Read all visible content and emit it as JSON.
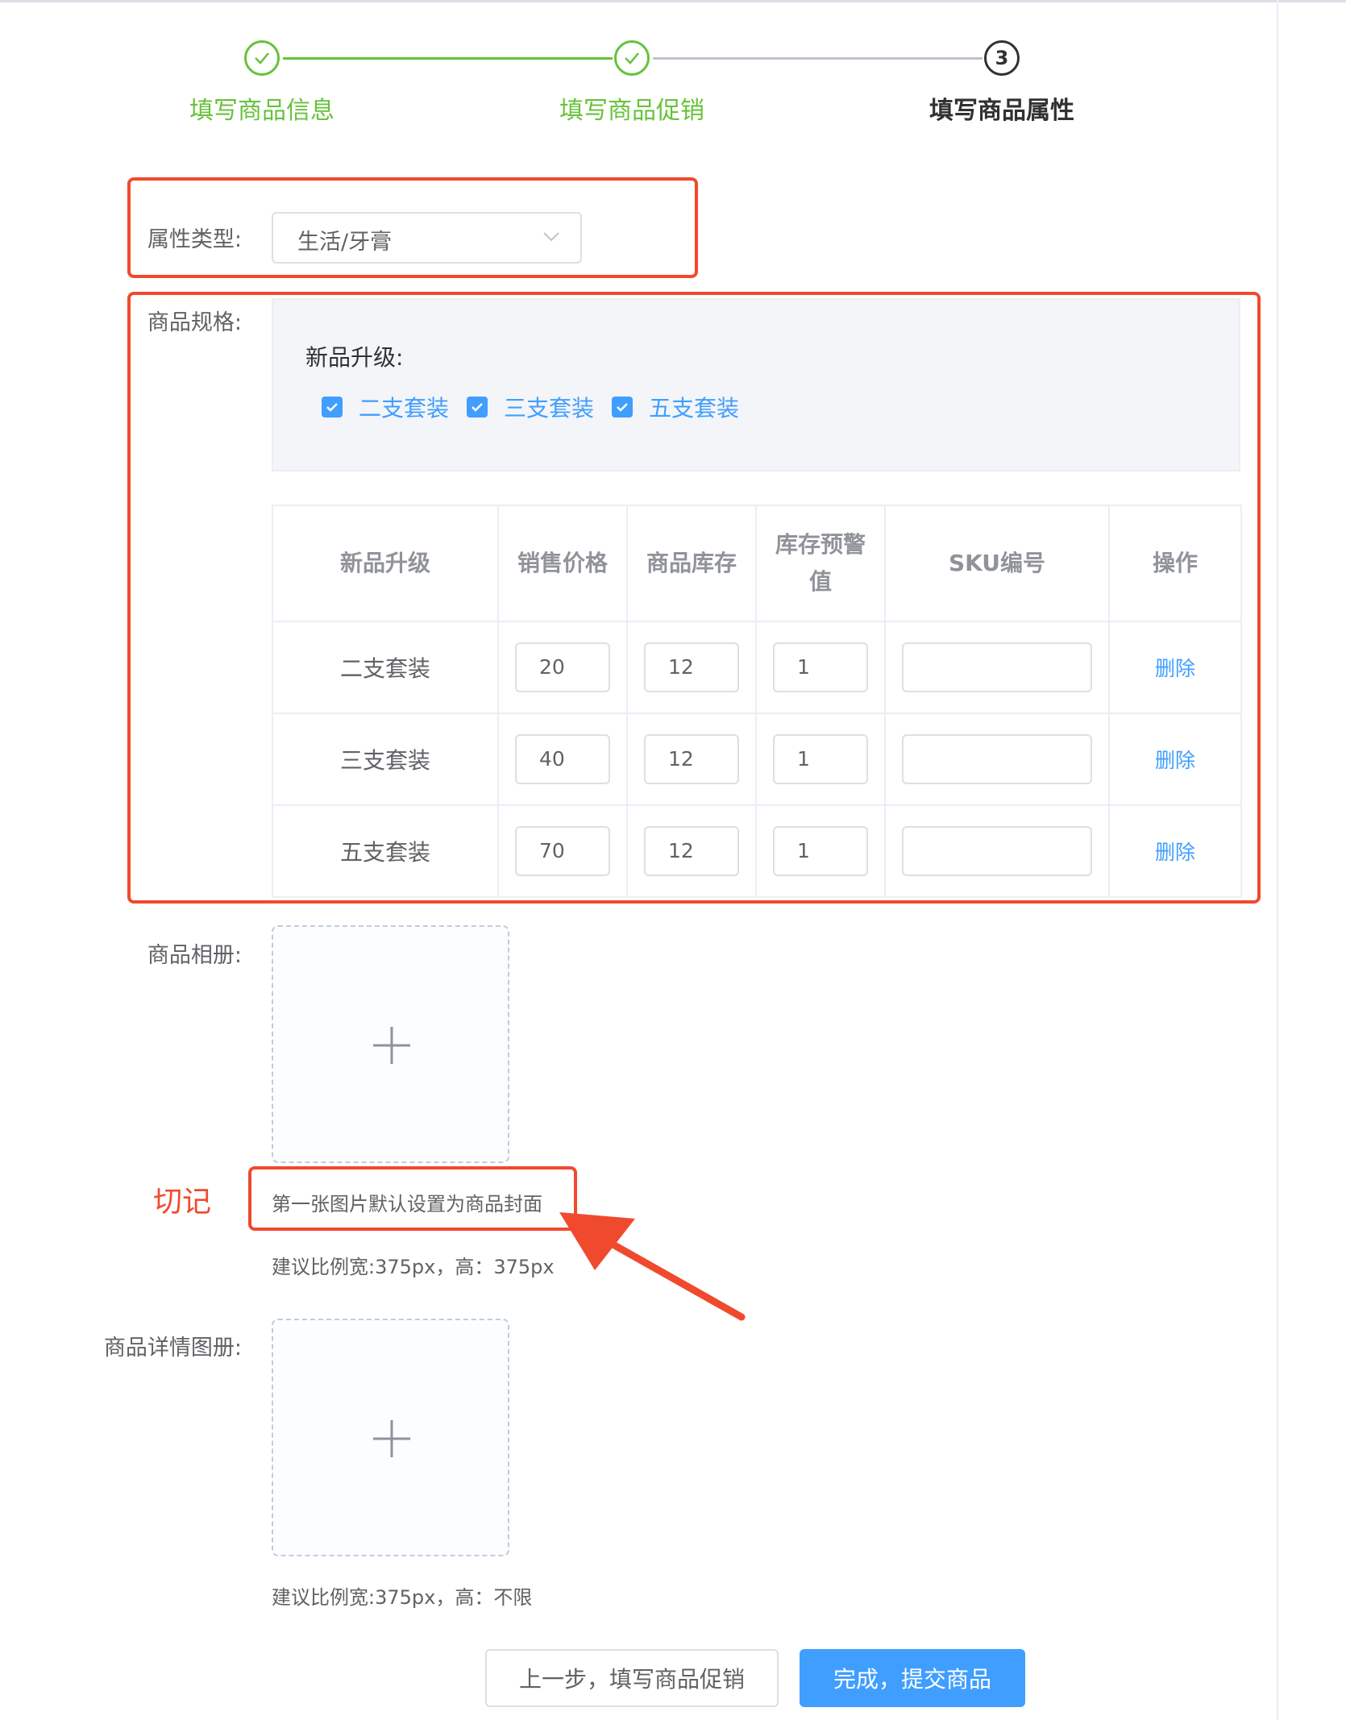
{
  "steps": [
    {
      "title": "填写商品信息",
      "status": "done"
    },
    {
      "title": "填写商品促销",
      "status": "done"
    },
    {
      "title": "填写商品属性",
      "status": "current",
      "number": "3"
    }
  ],
  "attr_type": {
    "label": "属性类型:",
    "value": "生活/牙膏"
  },
  "spec": {
    "label": "商品规格:",
    "group_title": "新品升级:",
    "options": [
      {
        "label": "二支套装",
        "checked": true
      },
      {
        "label": "三支套装",
        "checked": true
      },
      {
        "label": "五支套装",
        "checked": true
      }
    ]
  },
  "sku_table": {
    "headers": [
      "新品升级",
      "销售价格",
      "商品库存",
      "库存预警值",
      "SKU编号",
      "操作"
    ],
    "rows": [
      {
        "name": "二支套装",
        "price": "20",
        "stock": "12",
        "warn": "1",
        "sku": "",
        "action": "删除"
      },
      {
        "name": "三支套装",
        "price": "40",
        "stock": "12",
        "warn": "1",
        "sku": "",
        "action": "删除"
      },
      {
        "name": "五支套装",
        "price": "70",
        "stock": "12",
        "warn": "1",
        "sku": "",
        "action": "删除"
      }
    ]
  },
  "album": {
    "label": "商品相册:",
    "cover_note": "第一张图片默认设置为商品封面",
    "size_hint": "建议比例宽:375px，高：375px"
  },
  "annotation": {
    "text": "切记",
    "color": "#f04a2e"
  },
  "detail_album": {
    "label": "商品详情图册:",
    "size_hint": "建议比例宽:375px，高：不限"
  },
  "buttons": {
    "prev": "上一步，填写商品促销",
    "submit": "完成，提交商品"
  },
  "colors": {
    "success": "#67c23a",
    "primary": "#409eff",
    "highlight": "#f04a2e"
  }
}
